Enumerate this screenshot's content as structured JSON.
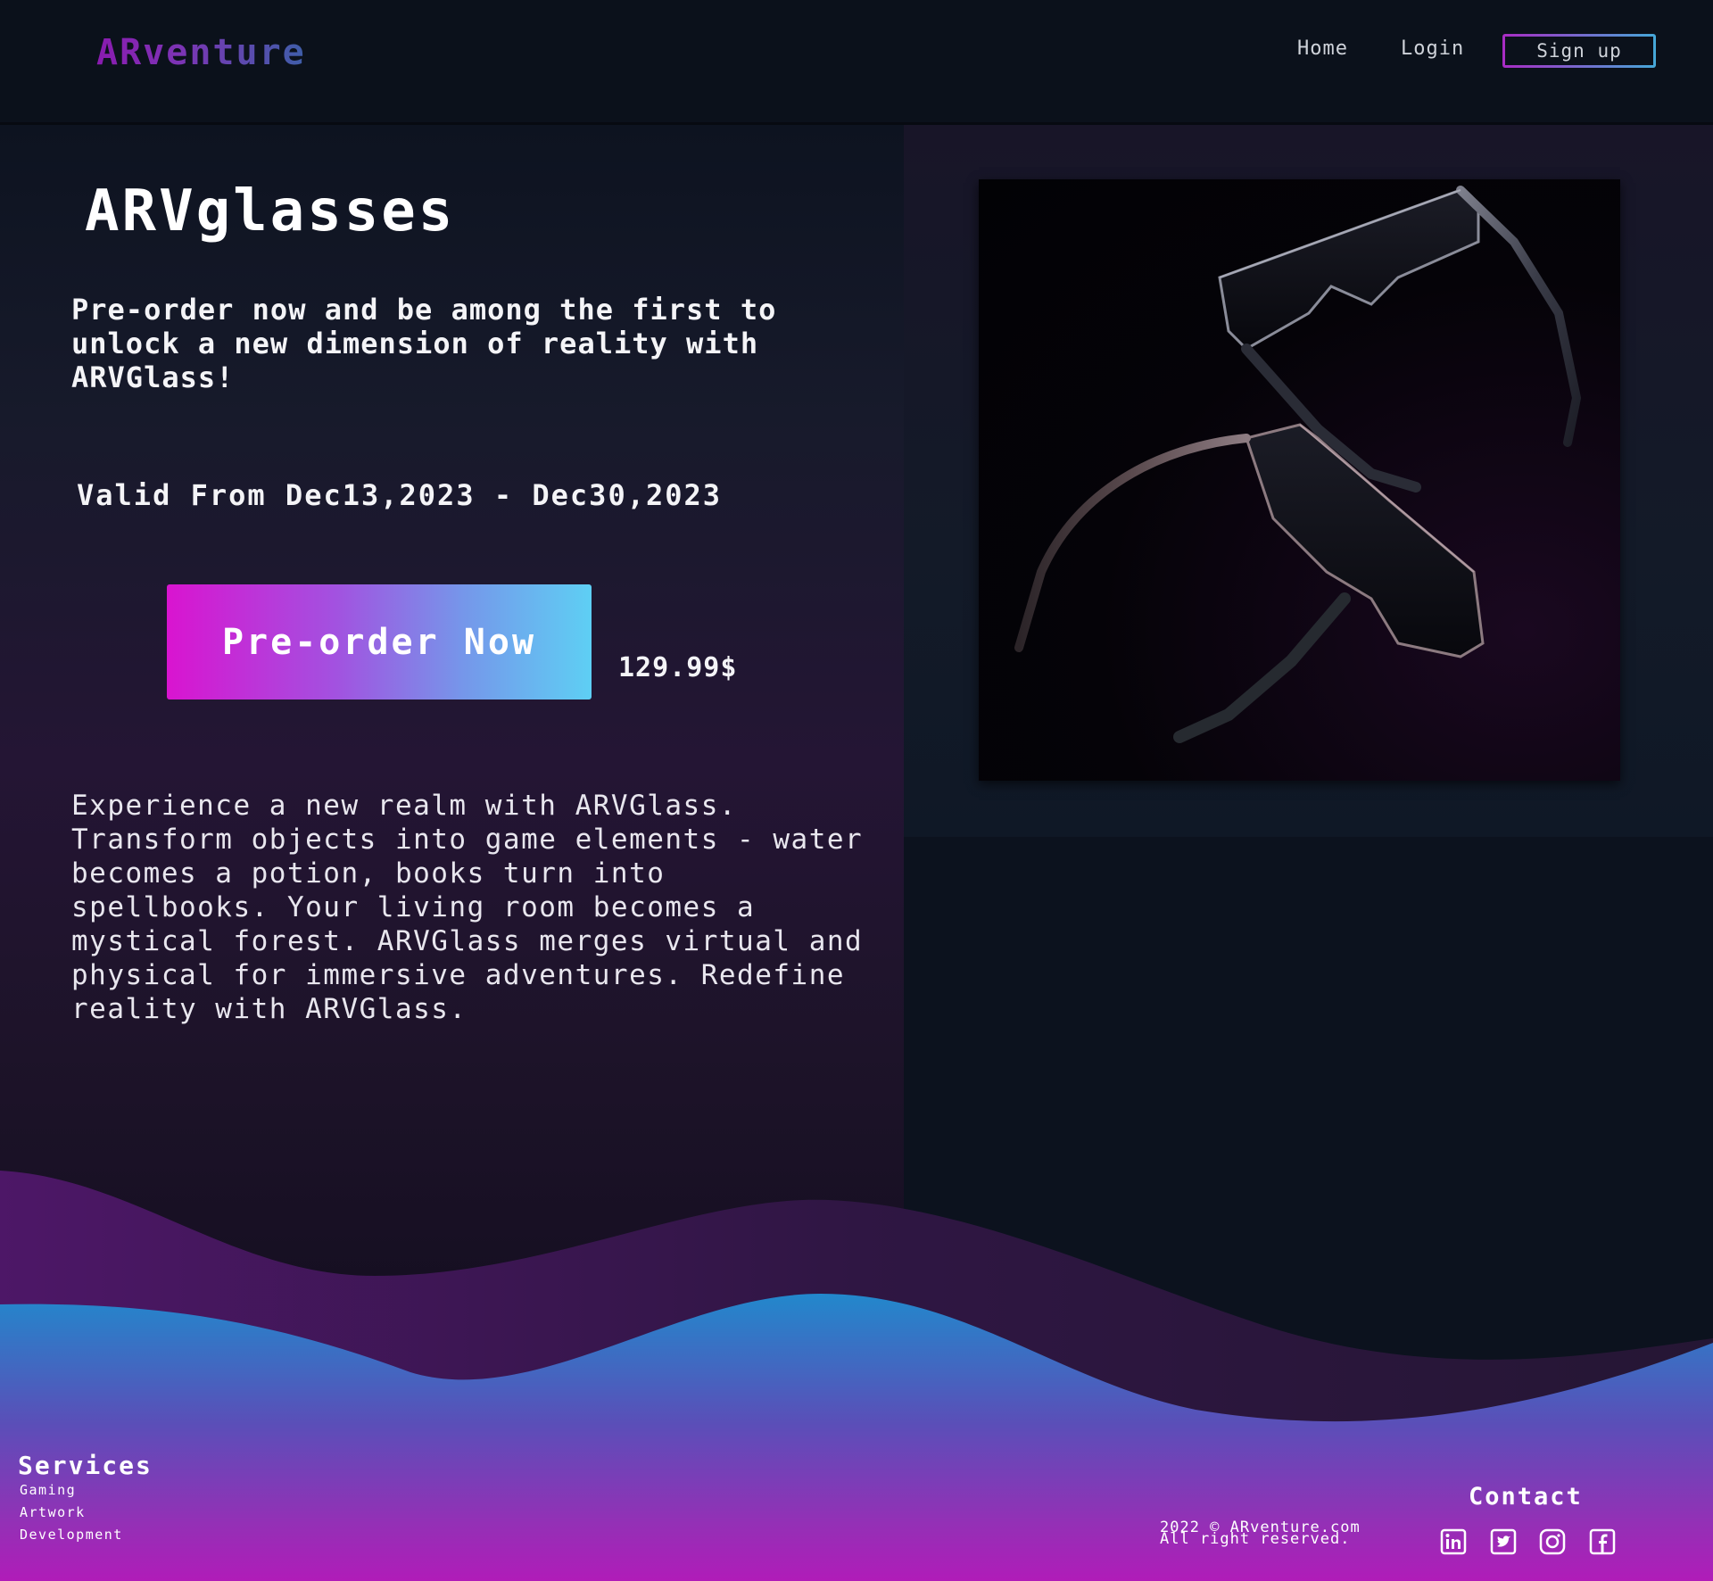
{
  "header": {
    "logo": "ARventure",
    "nav": {
      "home": "Home",
      "login": "Login",
      "signup": "Sign up"
    }
  },
  "product": {
    "title": "ARVglasses",
    "tagline": "Pre-order now and be among the first to unlock a new dimension of reality with ARVGlass!",
    "validity": "Valid From Dec13,2023 - Dec30,2023",
    "cta": "Pre-order Now",
    "price": "129.99$",
    "description": "Experience a new realm with ARVGlass. Transform objects into game elements - water becomes a potion, books turn into spellbooks. Your living room becomes a mystical forest. ARVGlass merges virtual and physical for immersive adventures. Redefine reality with ARVGlass."
  },
  "footer": {
    "services": {
      "heading": "Services",
      "items": [
        "Gaming",
        "Artwork",
        "Development"
      ]
    },
    "copyright_line1": "2022 © ARventure.com",
    "copyright_line2": "All right reserved.",
    "contact_heading": "Contact",
    "social_icons": [
      "linkedin-icon",
      "twitter-icon",
      "instagram-icon",
      "facebook-icon"
    ]
  },
  "colors": {
    "background": "#0c121e",
    "accent_pink": "#d914d0",
    "accent_cyan": "#5ecff4",
    "logo_purple": "#8a1bb0",
    "footer_gradient_bottom": "#b01cb8"
  }
}
